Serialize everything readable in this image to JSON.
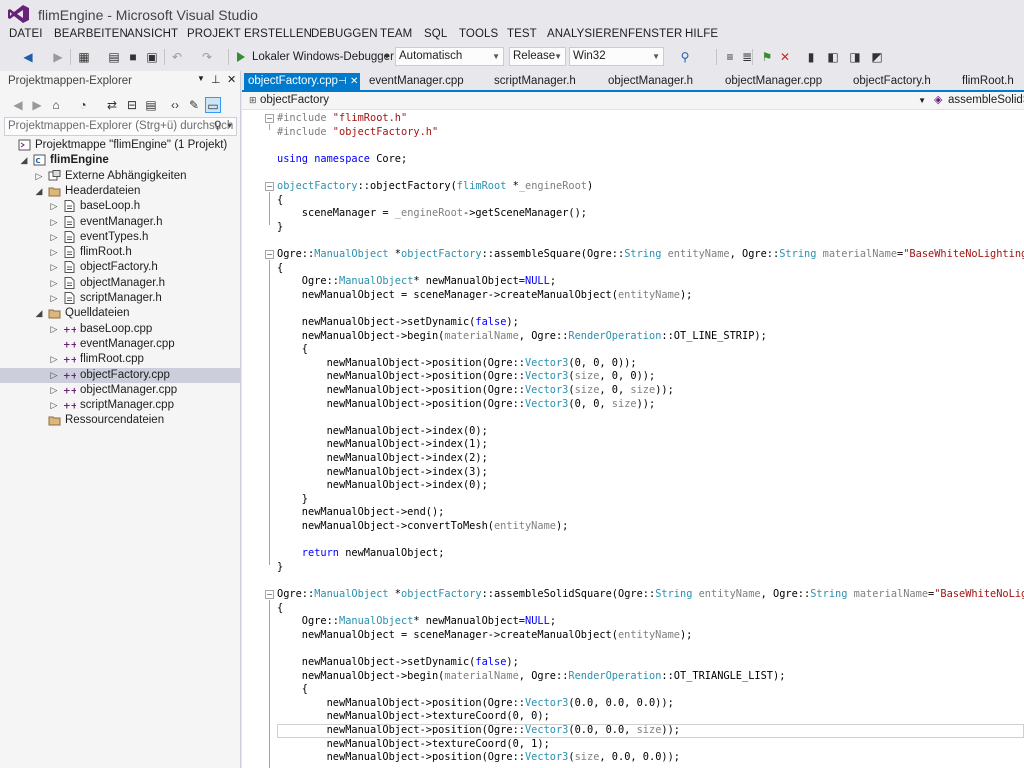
{
  "window": {
    "title": "flimEngine - Microsoft Visual Studio"
  },
  "menu": [
    "DATEI",
    "BEARBEITEN",
    "ANSICHT",
    "PROJEKT",
    "ERSTELLEN",
    "DEBUGGEN",
    "TEAM",
    "SQL",
    "TOOLS",
    "TEST",
    "ANALYSIEREN",
    "FENSTER",
    "HILFE"
  ],
  "toolbar": {
    "run_label": "Lokaler Windows-Debugger",
    "config_combo": "Automatisch",
    "build_combo": "Release",
    "platform_combo": "Win32"
  },
  "explorer": {
    "title": "Projektmappen-Explorer",
    "search_placeholder": "Projektmappen-Explorer (Strg+ü) durchsuch",
    "tree": [
      {
        "label": "Projektmappe \"flimEngine\" (1 Projekt)",
        "depth": 0,
        "exp": "",
        "icon": "solution-icon",
        "bold": false
      },
      {
        "label": "flimEngine",
        "depth": 1,
        "exp": "open",
        "icon": "project-icon",
        "bold": true
      },
      {
        "label": "Externe Abhängigkeiten",
        "depth": 2,
        "exp": "closed",
        "icon": "dependencies-icon",
        "bold": false
      },
      {
        "label": "Headerdateien",
        "depth": 2,
        "exp": "open",
        "icon": "folder-icon",
        "bold": false
      },
      {
        "label": "baseLoop.h",
        "depth": 3,
        "exp": "closed",
        "icon": "header-file-icon",
        "bold": false
      },
      {
        "label": "eventManager.h",
        "depth": 3,
        "exp": "closed",
        "icon": "header-file-icon",
        "bold": false
      },
      {
        "label": "eventTypes.h",
        "depth": 3,
        "exp": "closed",
        "icon": "header-file-icon",
        "bold": false
      },
      {
        "label": "flimRoot.h",
        "depth": 3,
        "exp": "closed",
        "icon": "header-file-icon",
        "bold": false
      },
      {
        "label": "objectFactory.h",
        "depth": 3,
        "exp": "closed",
        "icon": "header-file-icon",
        "bold": false
      },
      {
        "label": "objectManager.h",
        "depth": 3,
        "exp": "closed",
        "icon": "header-file-icon",
        "bold": false
      },
      {
        "label": "scriptManager.h",
        "depth": 3,
        "exp": "closed",
        "icon": "header-file-icon",
        "bold": false
      },
      {
        "label": "Quelldateien",
        "depth": 2,
        "exp": "open",
        "icon": "folder-icon",
        "bold": false
      },
      {
        "label": "baseLoop.cpp",
        "depth": 3,
        "exp": "closed",
        "icon": "cpp-file-icon",
        "bold": false
      },
      {
        "label": "eventManager.cpp",
        "depth": 3,
        "exp": "",
        "icon": "cpp-file-icon",
        "bold": false
      },
      {
        "label": "flimRoot.cpp",
        "depth": 3,
        "exp": "closed",
        "icon": "cpp-file-icon",
        "bold": false
      },
      {
        "label": "objectFactory.cpp",
        "depth": 3,
        "exp": "closed",
        "icon": "cpp-file-icon",
        "bold": false,
        "selected": true
      },
      {
        "label": "objectManager.cpp",
        "depth": 3,
        "exp": "closed",
        "icon": "cpp-file-icon",
        "bold": false
      },
      {
        "label": "scriptManager.cpp",
        "depth": 3,
        "exp": "closed",
        "icon": "cpp-file-icon",
        "bold": false
      },
      {
        "label": "Ressourcendateien",
        "depth": 2,
        "exp": "",
        "icon": "folder-icon",
        "bold": false
      }
    ]
  },
  "tabs": [
    {
      "label": "objectFactory.cpp",
      "active": true
    },
    {
      "label": "eventManager.cpp",
      "active": false
    },
    {
      "label": "scriptManager.h",
      "active": false
    },
    {
      "label": "objectManager.h",
      "active": false
    },
    {
      "label": "objectManager.cpp",
      "active": false
    },
    {
      "label": "objectFactory.h",
      "active": false
    },
    {
      "label": "flimRoot.h",
      "active": false
    }
  ],
  "navbar": {
    "class_scope": "objectFactory",
    "member_scope": "assembleSolidSqua"
  },
  "code": [
    [
      [
        "pp",
        "#include "
      ],
      [
        "str",
        "\"flimRoot.h\""
      ]
    ],
    [
      [
        "pp",
        "#include "
      ],
      [
        "str",
        "\"objectFactory.h\""
      ]
    ],
    [],
    [
      [
        "kw",
        "using namespace "
      ],
      [
        "plain",
        "Core;"
      ]
    ],
    [],
    [
      [
        "type",
        "objectFactory"
      ],
      [
        "plain",
        "::objectFactory("
      ],
      [
        "type",
        "flimRoot"
      ],
      [
        "plain",
        " *"
      ],
      [
        "par",
        "_engineRoot"
      ],
      [
        "plain",
        ")"
      ]
    ],
    [
      [
        "plain",
        "{"
      ]
    ],
    [
      [
        "plain",
        "    sceneManager = "
      ],
      [
        "par",
        "_engineRoot"
      ],
      [
        "plain",
        "->getSceneManager();"
      ]
    ],
    [
      [
        "plain",
        "}"
      ]
    ],
    [],
    [
      [
        "plain",
        "Ogre::"
      ],
      [
        "type",
        "ManualObject"
      ],
      [
        "plain",
        " *"
      ],
      [
        "type",
        "objectFactory"
      ],
      [
        "plain",
        "::assembleSquare(Ogre::"
      ],
      [
        "type",
        "String"
      ],
      [
        "plain",
        " "
      ],
      [
        "par",
        "entityName"
      ],
      [
        "plain",
        ", Ogre::"
      ],
      [
        "type",
        "String"
      ],
      [
        "plain",
        " "
      ],
      [
        "par",
        "materialName"
      ],
      [
        "plain",
        "="
      ],
      [
        "str",
        "\"BaseWhiteNoLighting\""
      ],
      [
        "plain",
        ", O"
      ]
    ],
    [
      [
        "plain",
        "{"
      ]
    ],
    [
      [
        "plain",
        "    Ogre::"
      ],
      [
        "type",
        "ManualObject"
      ],
      [
        "plain",
        "* newManualObject="
      ],
      [
        "kw",
        "NULL"
      ],
      [
        "plain",
        ";"
      ]
    ],
    [
      [
        "plain",
        "    newManualObject = sceneManager->createManualObject("
      ],
      [
        "par",
        "entityName"
      ],
      [
        "plain",
        ");"
      ]
    ],
    [],
    [
      [
        "plain",
        "    newManualObject->setDynamic("
      ],
      [
        "kw",
        "false"
      ],
      [
        "plain",
        ");"
      ]
    ],
    [
      [
        "plain",
        "    newManualObject->begin("
      ],
      [
        "par",
        "materialName"
      ],
      [
        "plain",
        ", Ogre::"
      ],
      [
        "type",
        "RenderOperation"
      ],
      [
        "plain",
        "::OT_LINE_STRIP);"
      ]
    ],
    [
      [
        "plain",
        "    {"
      ]
    ],
    [
      [
        "plain",
        "        newManualObject->position(Ogre::"
      ],
      [
        "type",
        "Vector3"
      ],
      [
        "plain",
        "(0, 0, 0));"
      ]
    ],
    [
      [
        "plain",
        "        newManualObject->position(Ogre::"
      ],
      [
        "type",
        "Vector3"
      ],
      [
        "plain",
        "("
      ],
      [
        "par",
        "size"
      ],
      [
        "plain",
        ", 0, 0));"
      ]
    ],
    [
      [
        "plain",
        "        newManualObject->position(Ogre::"
      ],
      [
        "type",
        "Vector3"
      ],
      [
        "plain",
        "("
      ],
      [
        "par",
        "size"
      ],
      [
        "plain",
        ", 0, "
      ],
      [
        "par",
        "size"
      ],
      [
        "plain",
        "));"
      ]
    ],
    [
      [
        "plain",
        "        newManualObject->position(Ogre::"
      ],
      [
        "type",
        "Vector3"
      ],
      [
        "plain",
        "(0, 0, "
      ],
      [
        "par",
        "size"
      ],
      [
        "plain",
        "));"
      ]
    ],
    [],
    [
      [
        "plain",
        "        newManualObject->index(0);"
      ]
    ],
    [
      [
        "plain",
        "        newManualObject->index(1);"
      ]
    ],
    [
      [
        "plain",
        "        newManualObject->index(2);"
      ]
    ],
    [
      [
        "plain",
        "        newManualObject->index(3);"
      ]
    ],
    [
      [
        "plain",
        "        newManualObject->index(0);"
      ]
    ],
    [
      [
        "plain",
        "    }"
      ]
    ],
    [
      [
        "plain",
        "    newManualObject->end();"
      ]
    ],
    [
      [
        "plain",
        "    newManualObject->convertToMesh("
      ],
      [
        "par",
        "entityName"
      ],
      [
        "plain",
        ");"
      ]
    ],
    [],
    [
      [
        "kw",
        "    return "
      ],
      [
        "plain",
        "newManualObject;"
      ]
    ],
    [
      [
        "plain",
        "}"
      ]
    ],
    [],
    [
      [
        "plain",
        "Ogre::"
      ],
      [
        "type",
        "ManualObject"
      ],
      [
        "plain",
        " *"
      ],
      [
        "type",
        "objectFactory"
      ],
      [
        "plain",
        "::assembleSolidSquare(Ogre::"
      ],
      [
        "type",
        "String"
      ],
      [
        "plain",
        " "
      ],
      [
        "par",
        "entityName"
      ],
      [
        "plain",
        ", Ogre::"
      ],
      [
        "type",
        "String"
      ],
      [
        "plain",
        " "
      ],
      [
        "par",
        "materialName"
      ],
      [
        "plain",
        "="
      ],
      [
        "str",
        "\"BaseWhiteNoLightin"
      ]
    ],
    [
      [
        "plain",
        "{"
      ]
    ],
    [
      [
        "plain",
        "    Ogre::"
      ],
      [
        "type",
        "ManualObject"
      ],
      [
        "plain",
        "* newManualObject="
      ],
      [
        "kw",
        "NULL"
      ],
      [
        "plain",
        ";"
      ]
    ],
    [
      [
        "plain",
        "    newManualObject = sceneManager->createManualObject("
      ],
      [
        "par",
        "entityName"
      ],
      [
        "plain",
        ");"
      ]
    ],
    [],
    [
      [
        "plain",
        "    newManualObject->setDynamic("
      ],
      [
        "kw",
        "false"
      ],
      [
        "plain",
        ");"
      ]
    ],
    [
      [
        "plain",
        "    newManualObject->begin("
      ],
      [
        "par",
        "materialName"
      ],
      [
        "plain",
        ", Ogre::"
      ],
      [
        "type",
        "RenderOperation"
      ],
      [
        "plain",
        "::OT_TRIANGLE_LIST);"
      ]
    ],
    [
      [
        "plain",
        "    {"
      ]
    ],
    [
      [
        "plain",
        "        newManualObject->position(Ogre::"
      ],
      [
        "type",
        "Vector3"
      ],
      [
        "plain",
        "(0.0, 0.0, 0.0));"
      ]
    ],
    [
      [
        "plain",
        "        newManualObject->textureCoord(0, 0);"
      ]
    ],
    [
      [
        "plain",
        "        newManualObject->position(Ogre::"
      ],
      [
        "type",
        "Vector3"
      ],
      [
        "plain",
        "(0.0, 0.0, "
      ],
      [
        "par",
        "size"
      ],
      [
        "plain",
        "));"
      ]
    ],
    [
      [
        "plain",
        "        newManualObject->textureCoord(0, 1);"
      ]
    ],
    [
      [
        "plain",
        "        newManualObject->position(Ogre::"
      ],
      [
        "type",
        "Vector3"
      ],
      [
        "plain",
        "("
      ],
      [
        "par",
        "size"
      ],
      [
        "plain",
        ", 0.0, 0.0));"
      ]
    ]
  ],
  "colors": {
    "accent": "#007acc",
    "keyword": "#0000ff",
    "type": "#2b91af",
    "string": "#a31515",
    "param": "#808080"
  }
}
